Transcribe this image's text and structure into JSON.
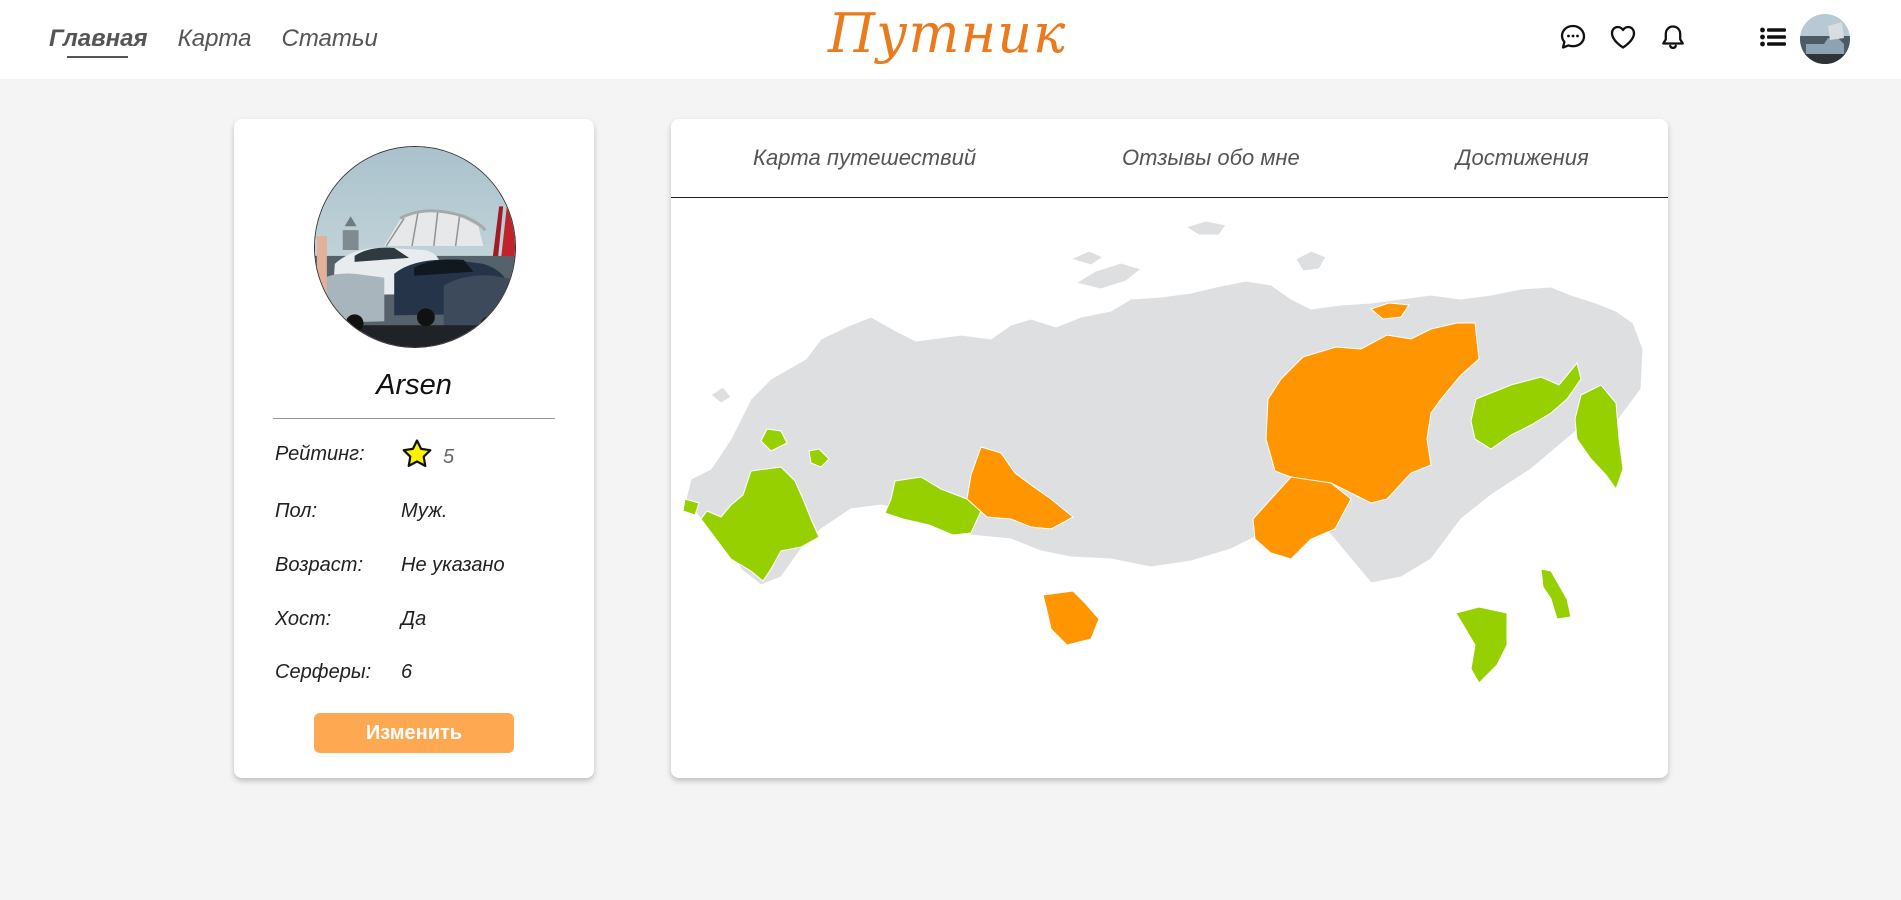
{
  "header": {
    "nav": [
      {
        "label": "Главная",
        "active": true
      },
      {
        "label": "Карта",
        "active": false
      },
      {
        "label": "Статьи",
        "active": false
      }
    ],
    "logo": "Путник",
    "icons": [
      "chat-icon",
      "heart-icon",
      "bell-icon",
      "list-menu-icon"
    ]
  },
  "profile": {
    "name": "Arsen",
    "rating": {
      "label": "Рейтинг:",
      "value": "5",
      "icon": "star-icon"
    },
    "gender": {
      "label": "Пол:",
      "value": "Муж."
    },
    "age": {
      "label": "Возраст:",
      "value": "Не указано"
    },
    "host": {
      "label": "Хост:",
      "value": "Да"
    },
    "surfers": {
      "label": "Серферы:",
      "value": "6"
    },
    "edit_label": "Изменить"
  },
  "tabs": [
    {
      "label": "Карта путешествий"
    },
    {
      "label": "Отзывы обо мне"
    },
    {
      "label": "Достижения"
    }
  ],
  "map": {
    "colors": {
      "base": "#dedfe1",
      "visited": "#ff9500",
      "planned": "#97d000"
    },
    "visited_region_count": 5,
    "planned_region_count": 8
  },
  "colors": {
    "accent": "#ea7a1c",
    "button": "#ffa852",
    "background": "#f4f4f4"
  }
}
